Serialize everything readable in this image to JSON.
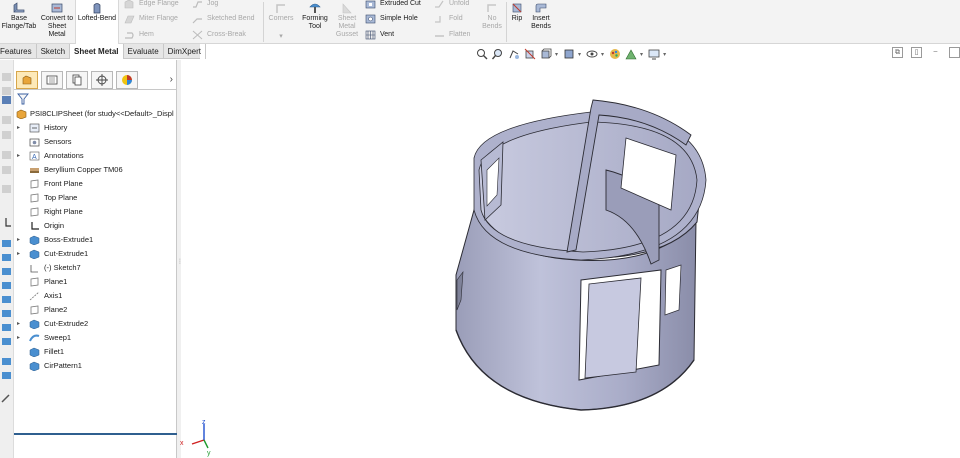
{
  "ribbon": {
    "base_flange": "Base Flange/Tab",
    "convert_to_sheet_metal": "Convert to Sheet Metal",
    "lofted_bend": "Lofted-Bend",
    "edge_flange": "Edge Flange",
    "miter_flange": "Miter Flange",
    "hem": "Hem",
    "jog": "Jog",
    "sketched_bend": "Sketched Bend",
    "cross_break": "Cross-Break",
    "corners": "Corners",
    "forming_tool": "Forming Tool",
    "sheet_metal_gusset": "Sheet Metal Gusset",
    "extruded_cut": "Extruded Cut",
    "simple_hole": "Simple Hole",
    "vent": "Vent",
    "unfold": "Unfold",
    "fold": "Fold",
    "flatten": "Flatten",
    "no_bends": "No Bends",
    "rip": "Rip",
    "insert_bends": "Insert Bends"
  },
  "tabs": [
    "Features",
    "Sketch",
    "Sheet Metal",
    "Evaluate",
    "DimXpert"
  ],
  "active_tab": "Sheet Metal",
  "tree": {
    "root": "PSI8CLIPSheet  (for study<<Default>_Displ",
    "items": [
      {
        "label": "History",
        "icon": "history-icon",
        "expandable": true
      },
      {
        "label": "Sensors",
        "icon": "sensor-icon",
        "expandable": false
      },
      {
        "label": "Annotations",
        "icon": "annotation-icon",
        "expandable": true
      },
      {
        "label": "Beryllium Copper TM06",
        "icon": "material-icon",
        "expandable": false
      },
      {
        "label": "Front Plane",
        "icon": "plane-icon",
        "expandable": false
      },
      {
        "label": "Top Plane",
        "icon": "plane-icon",
        "expandable": false
      },
      {
        "label": "Right Plane",
        "icon": "plane-icon",
        "expandable": false
      },
      {
        "label": "Origin",
        "icon": "origin-icon",
        "expandable": false
      },
      {
        "label": "Boss-Extrude1",
        "icon": "extrude-icon",
        "expandable": true
      },
      {
        "label": "Cut-Extrude1",
        "icon": "cut-icon",
        "expandable": true
      },
      {
        "label": "(-) Sketch7",
        "icon": "sketch-icon",
        "expandable": false
      },
      {
        "label": "Plane1",
        "icon": "plane-icon",
        "expandable": false
      },
      {
        "label": "Axis1",
        "icon": "axis-icon",
        "expandable": false
      },
      {
        "label": "Plane2",
        "icon": "plane-icon",
        "expandable": false
      },
      {
        "label": "Cut-Extrude2",
        "icon": "cut-icon",
        "expandable": true
      },
      {
        "label": "Sweep1",
        "icon": "sweep-icon",
        "expandable": true
      },
      {
        "label": "Fillet1",
        "icon": "fillet-icon",
        "expandable": false
      },
      {
        "label": "CirPattern1",
        "icon": "pattern-icon",
        "expandable": false
      }
    ]
  },
  "colors": {
    "ribbon_bg": "#f3f3f3",
    "model_body": "#b9bcd6",
    "model_dark": "#8e91ad",
    "model_light": "#dfe0ee",
    "edge": "#2b2b33",
    "rollback": "#2f5f8f"
  },
  "triad": {
    "x": "x",
    "z": "z",
    "y": "y"
  }
}
